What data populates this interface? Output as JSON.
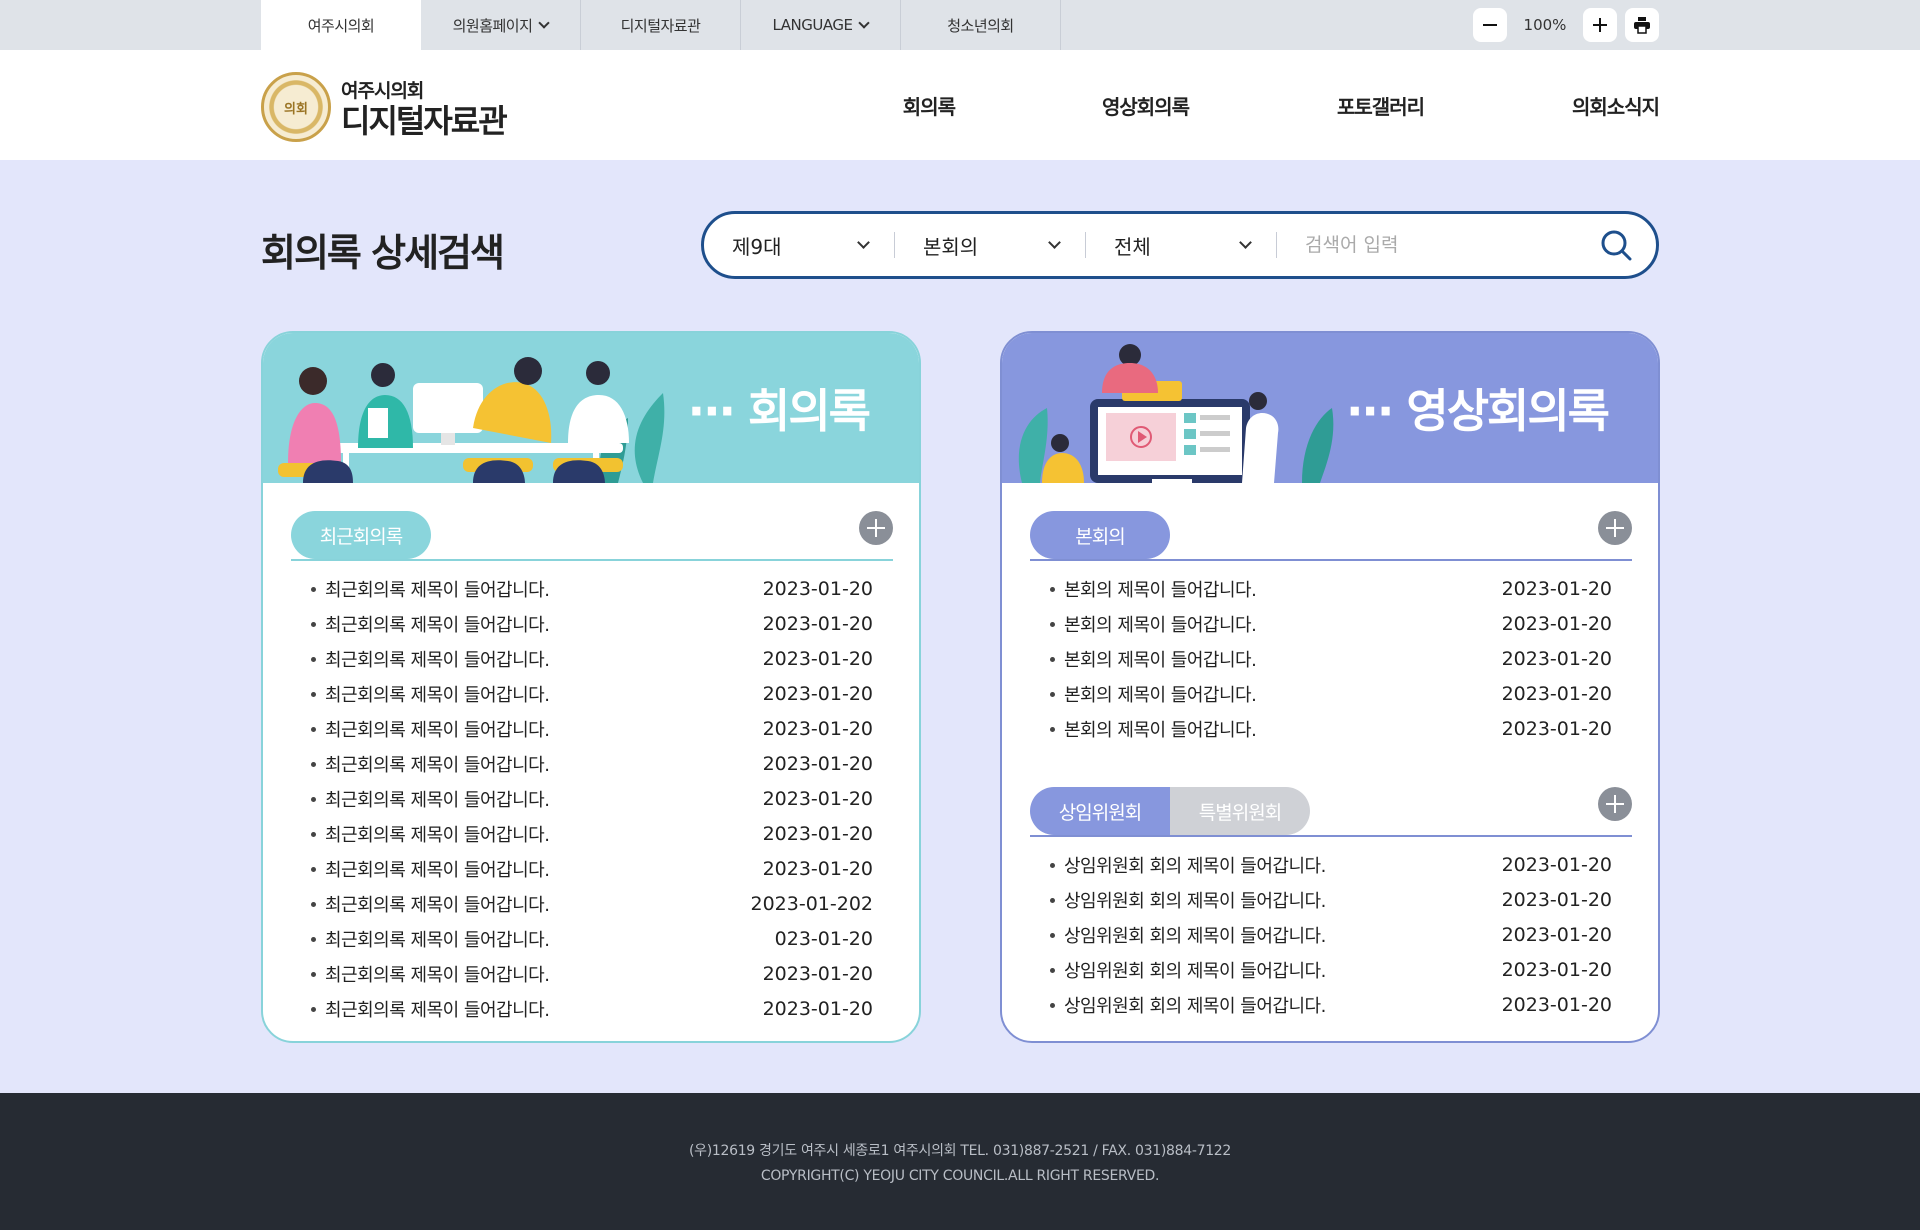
{
  "topbar": {
    "tabs": [
      {
        "label": "여주시의회",
        "active": true,
        "dropdown": false
      },
      {
        "label": "의원홈페이지",
        "active": false,
        "dropdown": true
      },
      {
        "label": "디지털자료관",
        "active": false,
        "dropdown": false
      },
      {
        "label": "LANGUAGE",
        "active": false,
        "dropdown": true
      },
      {
        "label": "청소년의회",
        "active": false,
        "dropdown": false
      }
    ],
    "zoom_value": "100%"
  },
  "header": {
    "seal_text": "의회",
    "logo_line1": "여주시의회",
    "logo_line2": "디지털자료관",
    "nav": [
      "회의록",
      "영상회의록",
      "포토갤러리",
      "의회소식지"
    ]
  },
  "search": {
    "title": "회의록 상세검색",
    "select1": "제9대",
    "select2": "본회의",
    "select3": "전체",
    "placeholder": "검색어 입력"
  },
  "left_card": {
    "banner_title": "··· 회의록",
    "section_label": "최근회의록",
    "items": [
      {
        "title": "최근회의록 제목이 들어갑니다.",
        "date": "2023-01-20"
      },
      {
        "title": "최근회의록 제목이 들어갑니다.",
        "date": "2023-01-20"
      },
      {
        "title": "최근회의록 제목이 들어갑니다.",
        "date": "2023-01-20"
      },
      {
        "title": "최근회의록 제목이 들어갑니다.",
        "date": "2023-01-20"
      },
      {
        "title": "최근회의록 제목이 들어갑니다.",
        "date": "2023-01-20"
      },
      {
        "title": "최근회의록 제목이 들어갑니다.",
        "date": "2023-01-20"
      },
      {
        "title": "최근회의록 제목이 들어갑니다.",
        "date": "2023-01-20"
      },
      {
        "title": "최근회의록 제목이 들어갑니다.",
        "date": "2023-01-20"
      },
      {
        "title": "최근회의록 제목이 들어갑니다.",
        "date": "2023-01-20"
      },
      {
        "title": "최근회의록 제목이 들어갑니다.",
        "date": "2023-01-202"
      },
      {
        "title": "최근회의록 제목이 들어갑니다.",
        "date": "023-01-20"
      },
      {
        "title": "최근회의록 제목이 들어갑니다.",
        "date": "2023-01-20"
      },
      {
        "title": "최근회의록 제목이 들어갑니다.",
        "date": "2023-01-20"
      }
    ]
  },
  "right_card": {
    "banner_title": "··· 영상회의록",
    "section1_label": "본회의",
    "section1_items": [
      {
        "title": "본회의 제목이 들어갑니다.",
        "date": "2023-01-20"
      },
      {
        "title": "본회의 제목이 들어갑니다.",
        "date": "2023-01-20"
      },
      {
        "title": "본회의 제목이 들어갑니다.",
        "date": "2023-01-20"
      },
      {
        "title": "본회의 제목이 들어갑니다.",
        "date": "2023-01-20"
      },
      {
        "title": "본회의 제목이 들어갑니다.",
        "date": "2023-01-20"
      }
    ],
    "section2_tab1": "상임위원회",
    "section2_tab2": "특별위원회",
    "section2_items": [
      {
        "title": "상임위원회 회의 제목이 들어갑니다.",
        "date": "2023-01-20"
      },
      {
        "title": "상임위원회 회의 제목이 들어갑니다.",
        "date": "2023-01-20"
      },
      {
        "title": "상임위원회 회의 제목이 들어갑니다.",
        "date": "2023-01-20"
      },
      {
        "title": "상임위원회 회의 제목이 들어갑니다.",
        "date": "2023-01-20"
      },
      {
        "title": "상임위원회 회의 제목이 들어갑니다.",
        "date": "2023-01-20"
      }
    ]
  },
  "footer": {
    "address": "(우)12619 경기도 여주시 세종로1 여주시의회 TEL. 031)887-2521 / FAX. 031)884-7122",
    "copyright": "COPYRIGHT(C) YEOJU CITY COUNCIL.ALL RIGHT RESERVED."
  },
  "colors": {
    "teal": "#8ad5dc",
    "periwinkle": "#8797de",
    "navy": "#1e4f8c",
    "page_bg": "#e3e6fb",
    "footer_bg": "#262b33"
  }
}
